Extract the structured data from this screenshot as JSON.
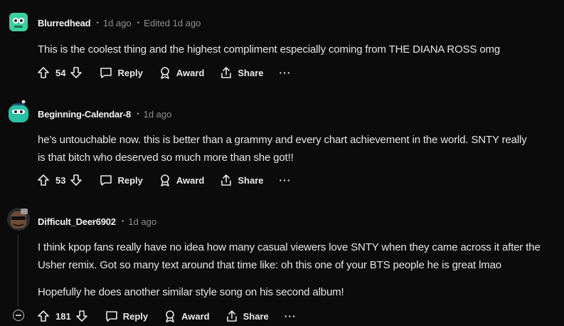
{
  "comments": [
    {
      "author": "Blurredhead",
      "time": "1d ago",
      "edited": "Edited 1d ago",
      "body": [
        "This is the coolest thing and the highest compliment especially coming from THE DIANA ROSS omg"
      ],
      "votes": "54"
    },
    {
      "author": "Beginning-Calendar-8",
      "time": "1d ago",
      "body": [
        "he’s untouchable now. this is better than a grammy and every chart achievement in the world. SNTY really is that bitch who deserved so much more than she got!!"
      ],
      "votes": "53"
    },
    {
      "author": "Difficult_Deer6902",
      "time": "1d ago",
      "body": [
        "I think kpop fans really have no idea how many casual viewers love SNTY when they came across it after the Usher remix. Got so many text around that time like: oh this one of your BTS people he is great lmao",
        "Hopefully he does another similar style song on his second album!"
      ],
      "votes": "181"
    }
  ],
  "actions": {
    "reply": "Reply",
    "award": "Award",
    "share": "Share",
    "more": "···"
  },
  "colors": {
    "background": "#0b0b0b",
    "text": "#e6e6e6",
    "muted": "#8f8f8f",
    "avatar1": "#3ecfa0",
    "avatar2": "#2bbfa5",
    "avatar3": "#6b4b3a"
  }
}
